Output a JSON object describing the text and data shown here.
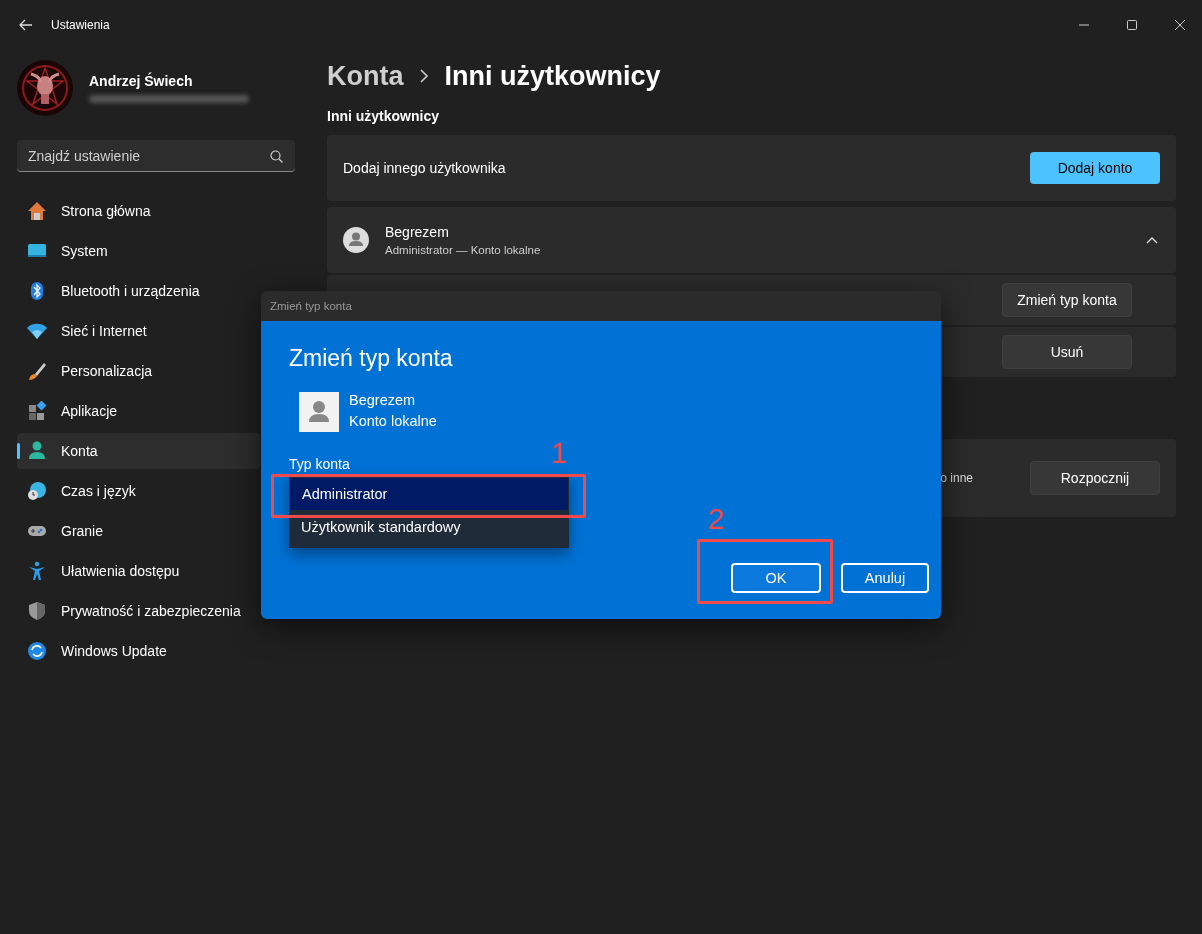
{
  "window": {
    "title": "Ustawienia"
  },
  "profile": {
    "name": "Andrzej Świech"
  },
  "search": {
    "placeholder": "Znajdź ustawienie"
  },
  "sidebar": {
    "items": [
      {
        "label": "Strona główna",
        "selected": false
      },
      {
        "label": "System",
        "selected": false
      },
      {
        "label": "Bluetooth i urządzenia",
        "selected": false
      },
      {
        "label": "Sieć i Internet",
        "selected": false
      },
      {
        "label": "Personalizacja",
        "selected": false
      },
      {
        "label": "Aplikacje",
        "selected": false
      },
      {
        "label": "Konta",
        "selected": true
      },
      {
        "label": "Czas i język",
        "selected": false
      },
      {
        "label": "Granie",
        "selected": false
      },
      {
        "label": "Ułatwienia dostępu",
        "selected": false
      },
      {
        "label": "Prywatność i zabezpieczenia",
        "selected": false
      },
      {
        "label": "Windows Update",
        "selected": false
      }
    ]
  },
  "breadcrumb": {
    "parent": "Konta",
    "current": "Inni użytkownicy"
  },
  "section_title": "Inni użytkownicy",
  "add_user": {
    "label": "Dodaj innego użytkownika",
    "button": "Dodaj konto"
  },
  "user": {
    "name": "Begrezem",
    "subtitle": "Administrator — Konto lokalne",
    "expanded": true,
    "actions": [
      {
        "label": "Zmień typ konta"
      },
      {
        "label": "Usuń"
      }
    ]
  },
  "kiosk": {
    "text": "o inne",
    "button": "Rozpocznij"
  },
  "dialog": {
    "window_title": "Zmień typ konta",
    "heading": "Zmień typ konta",
    "user_name": "Begrezem",
    "user_type": "Konto lokalne",
    "field_label": "Typ konta",
    "options": [
      {
        "label": "Administrator",
        "selected": true
      },
      {
        "label": "Użytkownik standardowy",
        "selected": false
      }
    ],
    "buttons": [
      {
        "label": "OK",
        "kind": "default"
      },
      {
        "label": "Anuluj",
        "kind": "normal"
      }
    ]
  },
  "annotations": [
    {
      "label": "1"
    },
    {
      "label": "2"
    }
  ]
}
